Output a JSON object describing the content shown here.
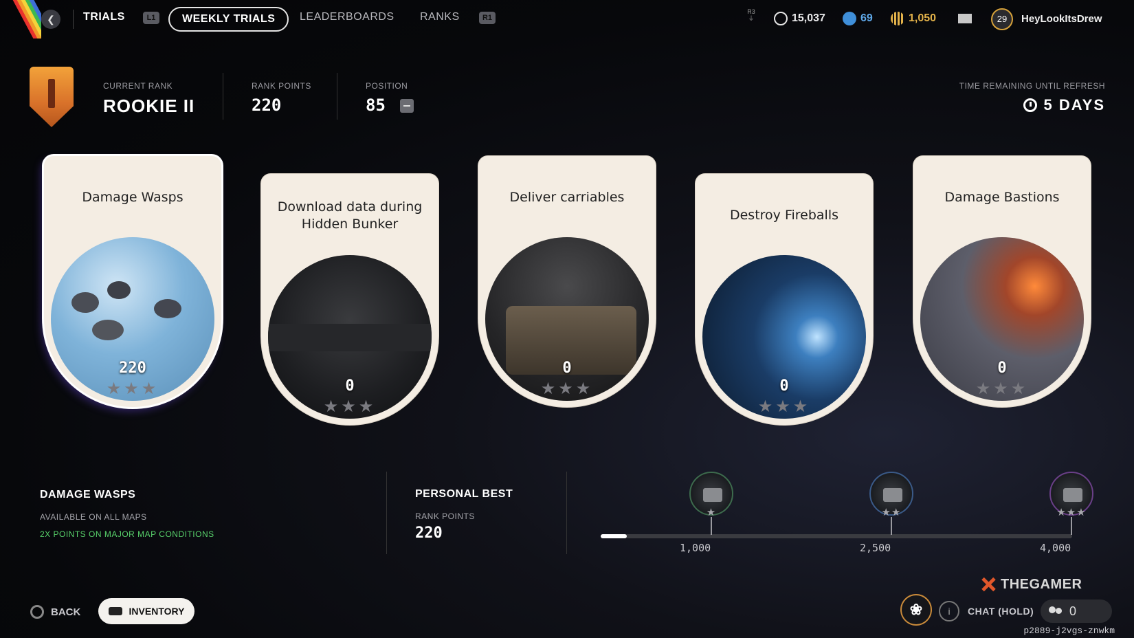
{
  "nav": {
    "trials": "TRIALS",
    "l1": "L1",
    "weekly_trials": "WEEKLY TRIALS",
    "leaderboards": "LEADERBOARDS",
    "ranks": "RANKS",
    "r1": "R1"
  },
  "status": {
    "r3": "R3",
    "currency_1": "15,037",
    "currency_2": "69",
    "currency_3": "1,050",
    "level": "29",
    "username": "HeyLookItsDrew"
  },
  "header": {
    "current_rank_label": "CURRENT RANK",
    "current_rank": "ROOKIE II",
    "rank_points_label": "RANK POINTS",
    "rank_points": "220",
    "position_label": "POSITION",
    "position": "85",
    "time_label": "TIME REMAINING UNTIL REFRESH",
    "time_value": "5 DAYS"
  },
  "cards": [
    {
      "title": "Damage Wasps",
      "score": "220",
      "stars": "★★★"
    },
    {
      "title": "Download data during Hidden Bunker",
      "score": "0",
      "stars": "★★★"
    },
    {
      "title": "Deliver carriables",
      "score": "0",
      "stars": "★★★"
    },
    {
      "title": "Destroy Fireballs",
      "score": "0",
      "stars": "★★★"
    },
    {
      "title": "Damage Bastions",
      "score": "0",
      "stars": "★★★"
    }
  ],
  "info": {
    "title": "DAMAGE WASPS",
    "availability": "AVAILABLE ON ALL MAPS",
    "bonus": "2X POINTS ON MAJOR MAP CONDITIONS"
  },
  "personal_best": {
    "title": "PERSONAL BEST",
    "label": "RANK POINTS",
    "value": "220"
  },
  "progress": {
    "current": 220,
    "max": 4000,
    "milestones": [
      {
        "value": "1,000",
        "stars": "★"
      },
      {
        "value": "2,500",
        "stars": "★★"
      },
      {
        "value": "4,000",
        "stars": "★★★"
      }
    ]
  },
  "footer": {
    "back": "BACK",
    "inventory": "INVENTORY",
    "chat": "CHAT (HOLD)",
    "party_count": "0",
    "watermark": "THEGAMER",
    "session_id": "p2889-j2vgs-znwkm"
  }
}
